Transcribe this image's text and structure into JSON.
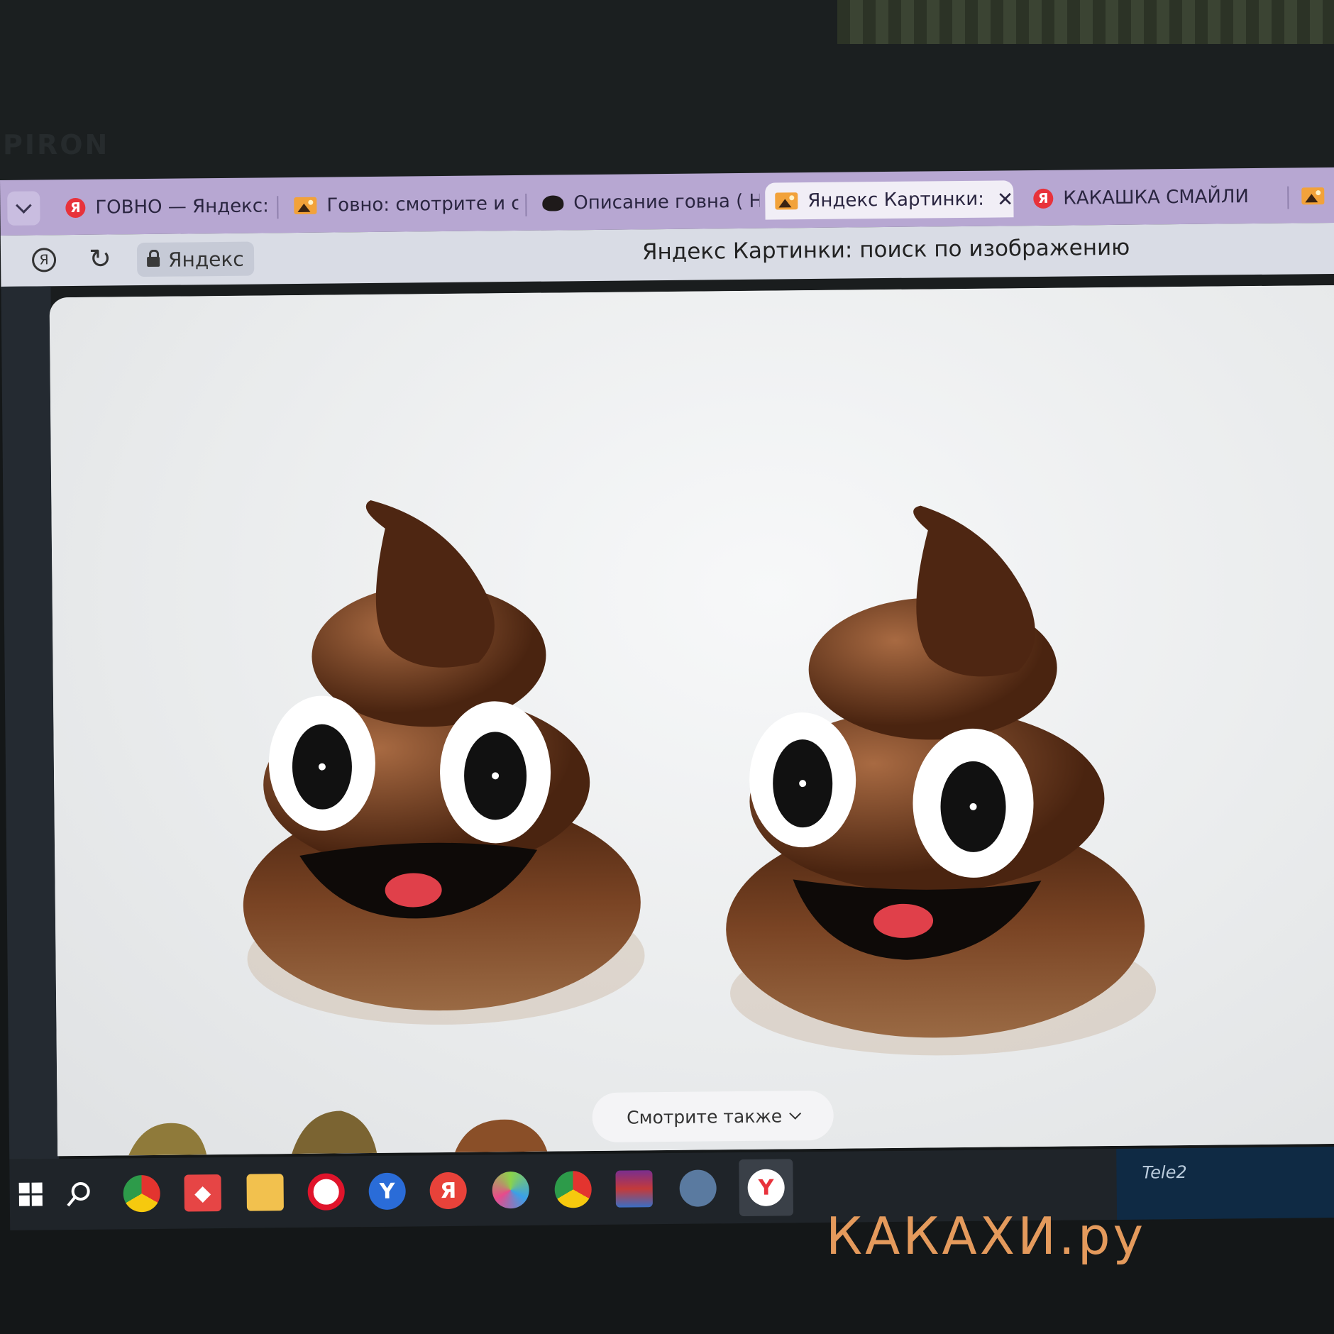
{
  "monitor": {
    "brand": "PIRON"
  },
  "tabs": [
    {
      "label": "ГОВНО — Яндекс: на",
      "favicon": "yandex-icon",
      "active": false
    },
    {
      "label": "Говно: смотрите и ск",
      "favicon": "image-icon",
      "active": false
    },
    {
      "label": "Описание говна ( Не",
      "favicon": "poo-icon",
      "active": false
    },
    {
      "label": "Яндекс Картинки:",
      "favicon": "image-icon",
      "active": true,
      "close": "✕"
    },
    {
      "label": "КАКАШКА СМАЙЛИ",
      "favicon": "yandex-icon",
      "active": false
    },
    {
      "label": "",
      "favicon": "image-icon",
      "active": false
    }
  ],
  "addressbar": {
    "site": "Яндекс",
    "title": "Яндекс Картинки: поиск по изображению"
  },
  "viewer": {
    "see_also": "Смотрите также"
  },
  "taskbar": {
    "items": [
      "windows-start",
      "search",
      "chrome",
      "anydesk",
      "file-explorer",
      "opera",
      "yandex-y",
      "yandex",
      "mixed-browser",
      "chrome-alt",
      "winrar",
      "network",
      "yandex-browser"
    ],
    "tray_text": "Tele2"
  },
  "watermark": {
    "text": "КАКАХИ.ру"
  },
  "colors": {
    "tabstrip": "#b7a7d2",
    "active_tab": "#f1eef6",
    "addressbar": "#d9dce5",
    "taskbar": "#1f2429",
    "poo_brown": "#6b3a1f",
    "watermark": "#e49a5c"
  }
}
